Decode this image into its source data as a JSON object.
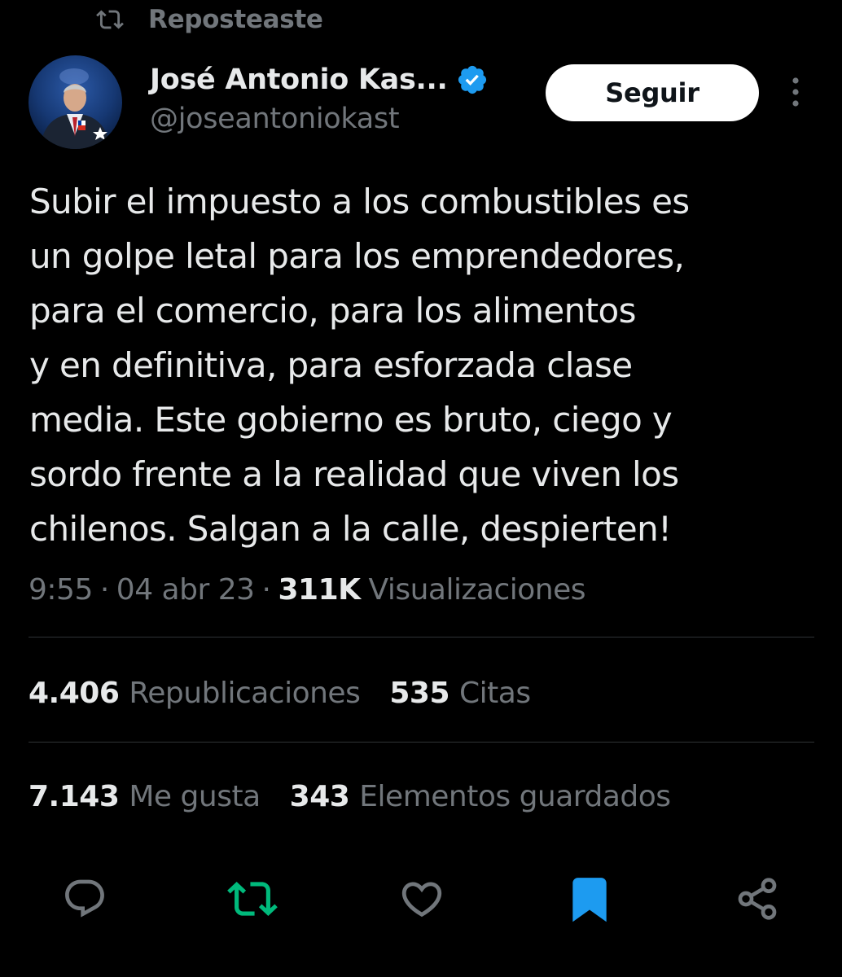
{
  "repost_banner": {
    "label": "Reposteaste",
    "icon": "repost-icon"
  },
  "author": {
    "display_name": "José Antonio Kas...",
    "handle": "@joseantoniokast",
    "verified": true,
    "verified_color": "#1d9bf0",
    "avatar_icon": "avatar-photo"
  },
  "header": {
    "follow_label": "Seguir",
    "more_icon": "more-vertical-icon"
  },
  "tweet": {
    "text": "Subir el impuesto a los combustibles es\nun golpe letal para los emprendedores,\npara el comercio, para los alimentos\ny en definitiva, para esforzada clase\nmedia. Este gobierno es bruto, ciego y\nsordo frente a la realidad que viven los\nchilenos. Salgan a la calle, despierten!",
    "time": "9:55",
    "date": "04 abr 23",
    "views_count": "311K",
    "views_label": "Visualizaciones"
  },
  "stats": {
    "reposts_count": "4.406",
    "reposts_label": "Republicaciones",
    "quotes_count": "535",
    "quotes_label": "Citas",
    "likes_count": "7.143",
    "likes_label": "Me gusta",
    "bookmarks_count": "343",
    "bookmarks_label": "Elementos guardados"
  },
  "actions": [
    {
      "name": "reply",
      "icon": "reply-icon",
      "active": false,
      "color": "#71767b"
    },
    {
      "name": "repost",
      "icon": "repost-icon",
      "active": true,
      "color": "#00ba7c"
    },
    {
      "name": "like",
      "icon": "heart-icon",
      "active": false,
      "color": "#71767b"
    },
    {
      "name": "bookmark",
      "icon": "bookmark-icon",
      "active": true,
      "color": "#1d9bf0"
    },
    {
      "name": "share",
      "icon": "share-icon",
      "active": false,
      "color": "#71767b"
    }
  ],
  "colors": {
    "background": "#000000",
    "text_primary": "#e7e9ea",
    "text_secondary": "#71767b",
    "divider": "#2f3336",
    "accent_blue": "#1d9bf0",
    "repost_green": "#00ba7c"
  }
}
